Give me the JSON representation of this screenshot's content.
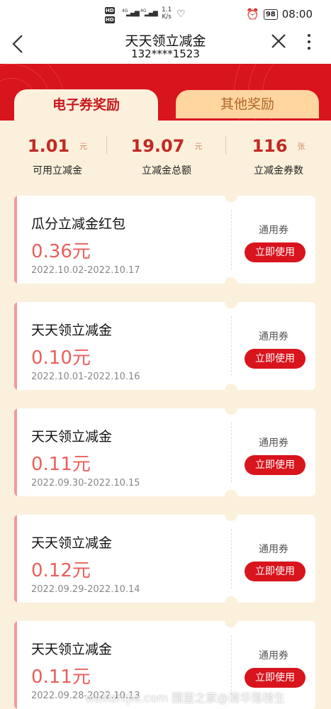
{
  "status_bar": {
    "net_left": "HD",
    "net_gen": "4G",
    "speed_val": "1.1",
    "speed_unit": "K/s",
    "battery": "98",
    "time": "08:00"
  },
  "header": {
    "title": "天天领立减金",
    "subtitle": "132****1523",
    "back_icon": "chevron-left-icon",
    "close_icon": "close-icon",
    "more_icon": "more-vertical-icon"
  },
  "tabs": [
    {
      "label": "电子券奖励",
      "active": true
    },
    {
      "label": "其他奖励",
      "active": false
    }
  ],
  "stats": [
    {
      "value": "1.01",
      "unit": "元",
      "label": "可用立减金"
    },
    {
      "value": "19.07",
      "unit": "元",
      "label": "立减金总额"
    },
    {
      "value": "116",
      "unit": "张",
      "label": "立减金券数"
    }
  ],
  "coupons": [
    {
      "name": "瓜分立减金红包",
      "amount": "0.36元",
      "dates": "2022.10.02-2022.10.17",
      "type": "通用券",
      "action": "立即使用"
    },
    {
      "name": "天天领立减金",
      "amount": "0.10元",
      "dates": "2022.10.01-2022.10.16",
      "type": "通用券",
      "action": "立即使用"
    },
    {
      "name": "天天领立减金",
      "amount": "0.11元",
      "dates": "2022.09.30-2022.10.15",
      "type": "通用券",
      "action": "立即使用"
    },
    {
      "name": "天天领立减金",
      "amount": "0.12元",
      "dates": "2022.09.29-2022.10.14",
      "type": "通用券",
      "action": "立即使用"
    },
    {
      "name": "天天领立减金",
      "amount": "0.11元",
      "dates": "2022.09.28-2022.10.13",
      "type": "通用券",
      "action": "立即使用"
    }
  ],
  "watermark": "weilizhijia.com 围里之家@清华落榜生",
  "colors": {
    "brand_red": "#d8141d",
    "amount_red": "#e8605c",
    "page_bg": "#fbf0dc",
    "inactive_tab": "#ffd6a0"
  }
}
